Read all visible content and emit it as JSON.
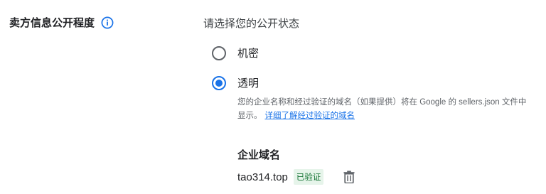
{
  "section": {
    "label": "卖方信息公开程度",
    "info_icon": "info-icon"
  },
  "visibility": {
    "prompt": "请选择您的公开状态",
    "options": [
      {
        "label": "机密",
        "selected": false
      },
      {
        "label": "透明",
        "selected": true
      }
    ],
    "helper_text": "您的企业名称和经过验证的域名（如果提供）将在 Google 的 sellers.json 文件中显示。",
    "helper_link": "详细了解经过验证的域名"
  },
  "domain": {
    "title": "企业域名",
    "value": "tao314.top",
    "status_badge": "已验证",
    "delete_icon": "trash-icon"
  },
  "colors": {
    "accent": "#1a73e8",
    "verified_bg": "#e6f4ea",
    "verified_text": "#137333",
    "muted_text": "#5f6368"
  }
}
